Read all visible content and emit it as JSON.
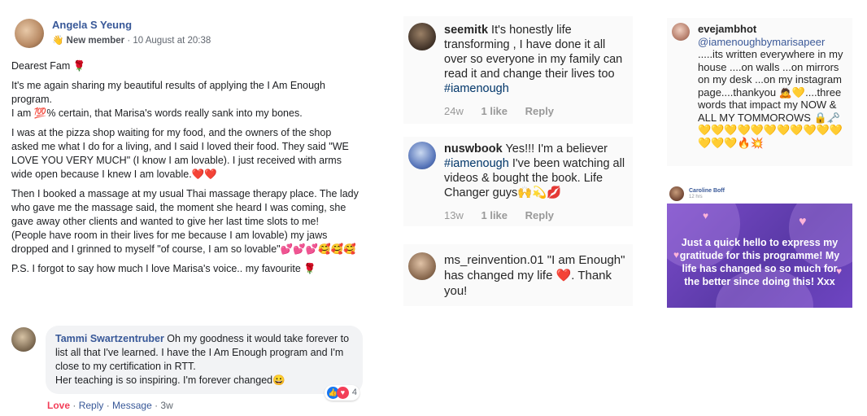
{
  "fb_post": {
    "author": "Angela S Yeung",
    "badge_icon": "wave-icon",
    "badge": "New member",
    "timestamp": " · 10 August at 20:38",
    "p1": "Dearest Fam 🌹",
    "p2a": "It's me again sharing my beautiful results of applying the I Am Enough program.",
    "p2b": "I am 💯% certain, that Marisa's words really sank into my bones.",
    "p3": "I was at the pizza shop waiting for my food, and the owners of the shop asked me what I do for a living, and I said I loved their food. They said \"WE LOVE YOU VERY MUCH\" (I know I am lovable). I just received with arms wide open because I knew I am lovable.❤️❤️",
    "p4a": "Then I booked a massage at my usual Thai massage therapy place. The lady who gave me the massage said, the moment she heard I was coming, she gave away other clients and wanted to give her last time slots to me!",
    "p4b": "(People have room in their lives for me because I am lovable) my jaws dropped and I grinned to myself \"of course, I am so lovable\"💕💕💕🥰🥰🥰",
    "p5": "P.S. I forgot to say how much I love Marisa's voice.. my favourite 🌹"
  },
  "fb_comment": {
    "author": "Tammi Swartzentruber",
    "text": " Oh my goodness it would take forever to list all that I've learned. I have the I Am Enough program and I'm close to my certification in RTT.",
    "text2": "Her teaching is so inspiring. I'm forever changed😀",
    "love": "Love",
    "reply": "Reply",
    "message": "Message",
    "time": "3w",
    "reaction_count": "4"
  },
  "ig_comments": [
    {
      "user": "seemitk",
      "text": " It's honestly life transforming , I have done it all over so everyone in my family can read it and change their lives too ",
      "tag": "#iamenough",
      "time": "24w",
      "likes": "1 like",
      "reply": "Reply"
    },
    {
      "user": "nuswbook",
      "text": " Yes!!! I'm a believer ",
      "tag": "#iamenough",
      "text2": " I've been watching all videos & bought the book. Life Changer guys🙌💫💋",
      "time": "13w",
      "likes": "1 like",
      "reply": "Reply"
    },
    {
      "user": "ms_reinvention.01",
      "text": " \"I am Enough\" has changed my life ❤️. Thank you!"
    },
    {
      "user": "evejambhot",
      "tag": "@iamenoughbymarisapeer",
      "text": ".....its written everywhere in my house ....on walls ...on mirrors on my desk ...on my instagram page....thankyou 🙇💛....three words that impact my NOW & ALL MY TOMMOROWS 🔒🗝️💛💛💛💛💛💛💛💛💛💛💛💛💛💛🔥💥"
    }
  ],
  "story_card": {
    "name": "Caroline Boff",
    "time": "12 hrs",
    "message": "Just a quick hello to express my gratitude for this programme! My life has changed so so much for the better since doing this! Xxx"
  },
  "colors": {
    "fb_link": "#385898",
    "love": "#f33e58",
    "ig_hashtag": "#003569",
    "story_bg": "#6e45c2"
  }
}
